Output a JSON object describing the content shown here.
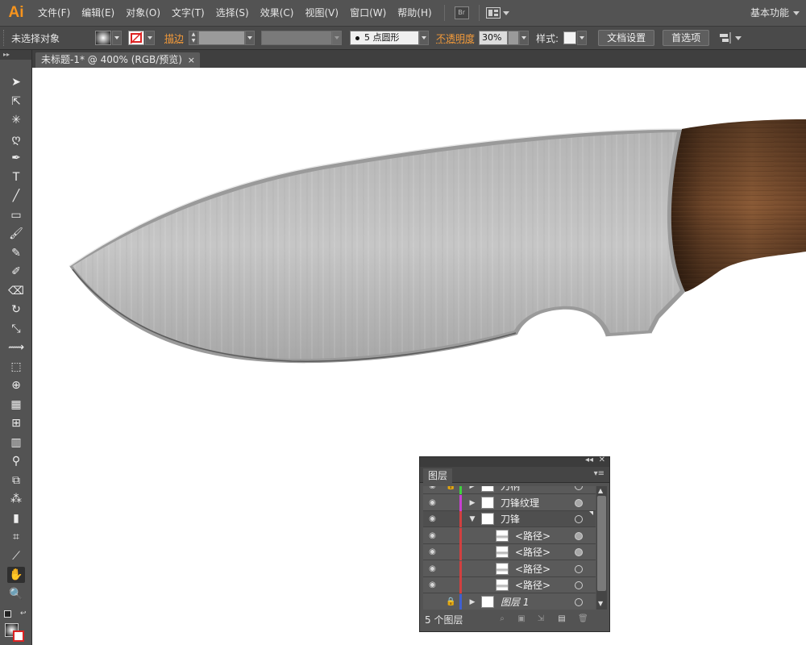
{
  "app": {
    "logo": "Ai"
  },
  "menu": {
    "items": [
      "文件(F)",
      "编辑(E)",
      "对象(O)",
      "文字(T)",
      "选择(S)",
      "效果(C)",
      "视图(V)",
      "窗口(W)",
      "帮助(H)"
    ],
    "bridge_label": "Br",
    "workspace": "基本功能"
  },
  "control_bar": {
    "selection_status": "未选择对象",
    "stroke_label": "描边",
    "brush_value": "5 点圆形",
    "opacity_label": "不透明度",
    "opacity_value": "30%",
    "style_label": "样式:",
    "doc_setup_button": "文档设置",
    "preferences_button": "首选项"
  },
  "document_tab": {
    "title": "未标题-1* @ 400% (RGB/预览)",
    "close": "×"
  },
  "tools": [
    "selection-icon",
    "direct-selection-icon",
    "magic-wand-icon",
    "lasso-icon",
    "pen-icon",
    "type-icon",
    "line-segment-icon",
    "rectangle-icon",
    "paintbrush-icon",
    "pencil-icon",
    "blob-brush-icon",
    "eraser-icon",
    "rotate-icon",
    "scale-icon",
    "width-icon",
    "free-transform-icon",
    "shape-builder-icon",
    "perspective-grid-icon",
    "mesh-icon",
    "gradient-icon",
    "eyedropper-icon",
    "blend-icon",
    "symbol-sprayer-icon",
    "column-graph-icon",
    "artboard-icon",
    "slice-icon",
    "hand-icon",
    "zoom-icon"
  ],
  "active_tool": "hand-icon",
  "layers_panel": {
    "title": "图层",
    "layer_count": "5 个图层",
    "rows": [
      {
        "name": "刀柄",
        "color": "#3fd13f",
        "expanded": false,
        "indent": 0,
        "visible": true,
        "locked": true,
        "target_filled": false
      },
      {
        "name": "刀锋纹理",
        "color": "#c83fd1",
        "expanded": false,
        "indent": 0,
        "visible": true,
        "locked": false,
        "target_filled": true
      },
      {
        "name": "刀锋",
        "color": "#d14040",
        "expanded": true,
        "indent": 0,
        "visible": true,
        "locked": false,
        "target_filled": false,
        "selected": true
      },
      {
        "name": "<路径>",
        "color": "#d14040",
        "indent": 1,
        "visible": true,
        "locked": false,
        "target_filled": true
      },
      {
        "name": "<路径>",
        "color": "#d14040",
        "indent": 1,
        "visible": true,
        "locked": false,
        "target_filled": true
      },
      {
        "name": "<路径>",
        "color": "#d14040",
        "indent": 1,
        "visible": true,
        "locked": false,
        "target_filled": false
      },
      {
        "name": "<路径>",
        "color": "#d14040",
        "indent": 1,
        "visible": true,
        "locked": false,
        "target_filled": false
      },
      {
        "name": "图层 1",
        "color": "#4060d1",
        "expanded": false,
        "indent": 0,
        "visible": false,
        "locked": true,
        "target_filled": false,
        "italic": true
      }
    ]
  },
  "colors": {
    "accent_orange": "#f29a3a",
    "ui_dark": "#535353",
    "blade_light": "#c4c4c4",
    "handle_wood": "#5c3a22"
  }
}
